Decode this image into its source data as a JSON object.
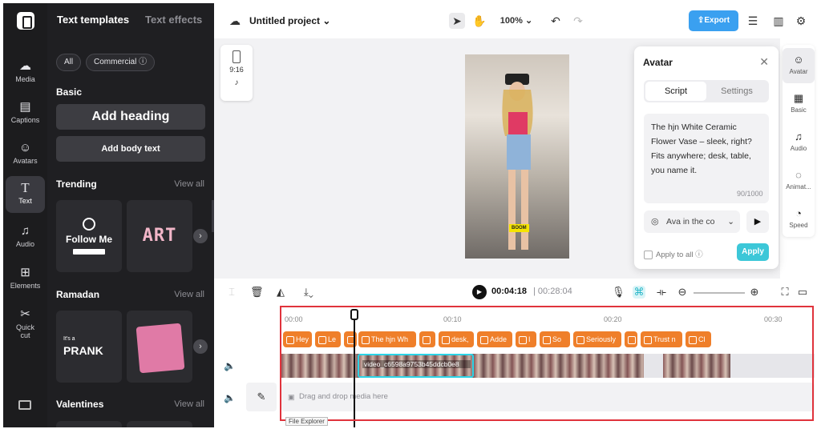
{
  "rail": {
    "items": [
      {
        "label": "Media",
        "icon": "media-icon"
      },
      {
        "label": "Captions",
        "icon": "captions-icon"
      },
      {
        "label": "Avatars",
        "icon": "avatars-icon"
      },
      {
        "label": "Text",
        "icon": "text-icon"
      },
      {
        "label": "Audio",
        "icon": "audio-icon"
      },
      {
        "label": "Elements",
        "icon": "elements-icon"
      },
      {
        "label": "Quick cut",
        "icon": "quick-cut-icon"
      }
    ]
  },
  "panel": {
    "tabs": [
      "Text templates",
      "Text effects"
    ],
    "filters": [
      "All",
      "Commercial ⓘ"
    ],
    "basic": {
      "title": "Basic",
      "heading_btn": "Add heading",
      "body_btn": "Add body text"
    },
    "trending": {
      "title": "Trending",
      "view_all": "View all",
      "items": [
        "Follow Me",
        "ART"
      ]
    },
    "ramadan": {
      "title": "Ramadan",
      "view_all": "View all",
      "items": [
        "PRANK"
      ]
    },
    "valentines": {
      "title": "Valentines",
      "view_all": "View all"
    }
  },
  "topbar": {
    "project_name": "Untitled project",
    "zoom": "100%",
    "export_label": "Export"
  },
  "canvas": {
    "ratio_label": "9:16",
    "video_badge": "BOOM"
  },
  "avatar_panel": {
    "title": "Avatar",
    "tabs": [
      "Script",
      "Settings"
    ],
    "script_text": "The hjn White Ceramic Flower Vase – sleek, right? Fits anywhere; desk, table, you name it.",
    "counter": "90/1000",
    "voice": "Ava in the co",
    "apply_all": "Apply to all",
    "apply_btn": "Apply"
  },
  "right_sidebar": {
    "items": [
      "Avatar",
      "Basic",
      "Audio",
      "Animat...",
      "Speed"
    ]
  },
  "timeline": {
    "current_time": "00:04:18",
    "total_time": "00:28:04",
    "ruler": [
      "00:00",
      "00:10",
      "00:20",
      "00:30"
    ],
    "text_clips": [
      "Hey",
      "Le",
      "",
      "The hjn Wh",
      "",
      "desk,",
      "Adde",
      "I",
      "So",
      "Seriously",
      "",
      "Trust n",
      "Cl"
    ],
    "selected_video_label": "video_c6598a9753b45ddcb0e8",
    "drop_text": "Drag and drop media here",
    "tooltip": "File Explorer"
  }
}
